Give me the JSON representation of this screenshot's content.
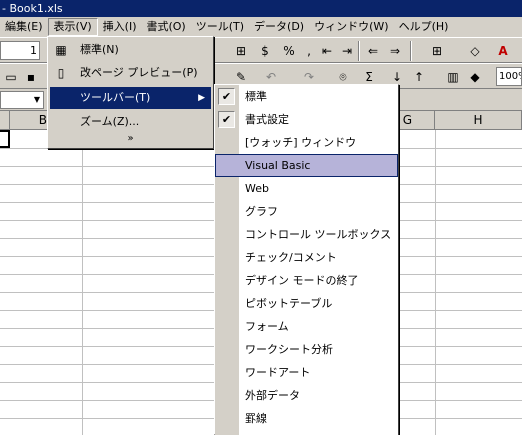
{
  "window": {
    "title": "- Book1.xls"
  },
  "menubar": [
    {
      "label": "編集(E)"
    },
    {
      "label": "表示(V)"
    },
    {
      "label": "挿入(I)"
    },
    {
      "label": "書式(O)"
    },
    {
      "label": "ツール(T)"
    },
    {
      "label": "データ(D)"
    },
    {
      "label": "ウィンドウ(W)"
    },
    {
      "label": "ヘルプ(H)"
    }
  ],
  "toolbar": {
    "font_size": "1",
    "zoom": "100%"
  },
  "sheet": {
    "columns": [
      "B",
      "G",
      "H"
    ]
  },
  "view_menu": {
    "items": [
      {
        "label": "標準(N)",
        "icon": "normal-view-icon"
      },
      {
        "label": "改ページ プレビュー(P)",
        "icon": "page-break-preview-icon"
      },
      {
        "label": "ツールバー(T)",
        "has_submenu": true
      },
      {
        "label": "ズーム(Z)..."
      }
    ],
    "more": "»"
  },
  "toolbars_submenu": {
    "items": [
      {
        "label": "標準",
        "checked": true
      },
      {
        "label": "書式設定",
        "checked": true
      },
      {
        "label": "[ウォッチ] ウィンドウ",
        "checked": false
      },
      {
        "label": "Visual Basic",
        "checked": false
      },
      {
        "label": "Web",
        "checked": false
      },
      {
        "label": "グラフ",
        "checked": false
      },
      {
        "label": "コントロール ツールボックス",
        "checked": false
      },
      {
        "label": "チェック/コメント",
        "checked": false
      },
      {
        "label": "デザイン モードの終了",
        "checked": false
      },
      {
        "label": "ピボットテーブル",
        "checked": false
      },
      {
        "label": "フォーム",
        "checked": false
      },
      {
        "label": "ワークシート分析",
        "checked": false
      },
      {
        "label": "ワードアート",
        "checked": false
      },
      {
        "label": "外部データ",
        "checked": false
      },
      {
        "label": "罫線",
        "checked": false
      }
    ]
  }
}
